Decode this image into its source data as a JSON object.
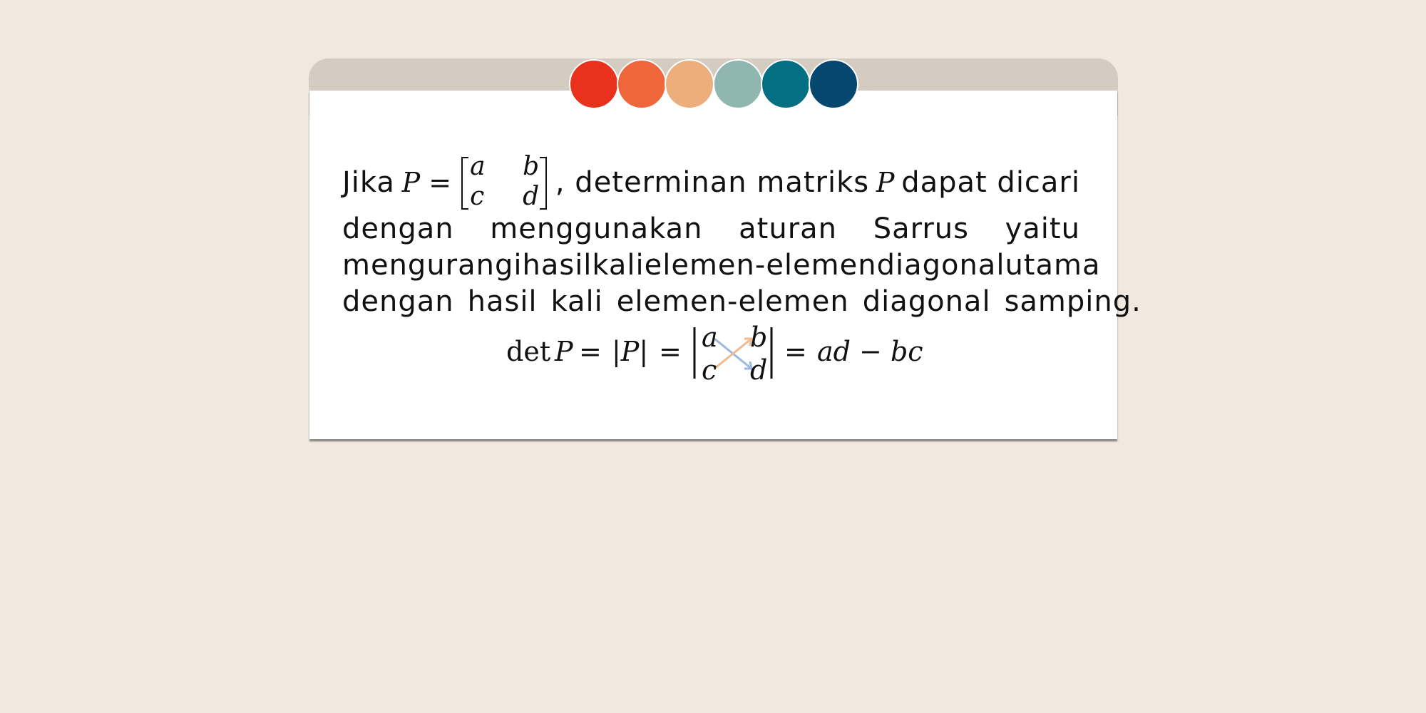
{
  "palette": [
    "#e8321e",
    "#ee6639",
    "#ecae7d",
    "#8fb7af",
    "#036f83",
    "#06476f"
  ],
  "paragraph": {
    "word_jika": "Jika",
    "var_p": "P",
    "equals": "=",
    "matrix": {
      "a": "a",
      "b": "b",
      "c": "c",
      "d": "d"
    },
    "line1_tail": ", determinan matriks",
    "var_p2": "P",
    "line1_end": "dapat dicari",
    "line2_words": [
      "dengan",
      "menggunakan",
      "aturan",
      "Sarrus",
      "yaitu"
    ],
    "line3_words": [
      "mengurangi",
      "hasil",
      "kali",
      "elemen-elemen",
      "diagonal",
      "utama"
    ],
    "line4_words": [
      "dengan",
      "hasil",
      "kali",
      "elemen-elemen",
      "diagonal",
      "samping."
    ]
  },
  "formula": {
    "det": "det",
    "p": "P",
    "eq1": "=",
    "abs_p": "|P|",
    "eq2": "=",
    "a": "a",
    "b": "b",
    "c": "c",
    "d": "d",
    "eq3": "=",
    "result": "ad − bc",
    "arrow_colors": {
      "main_diagonal": "#9bb9e0",
      "anti_diagonal": "#f0b98f"
    }
  }
}
